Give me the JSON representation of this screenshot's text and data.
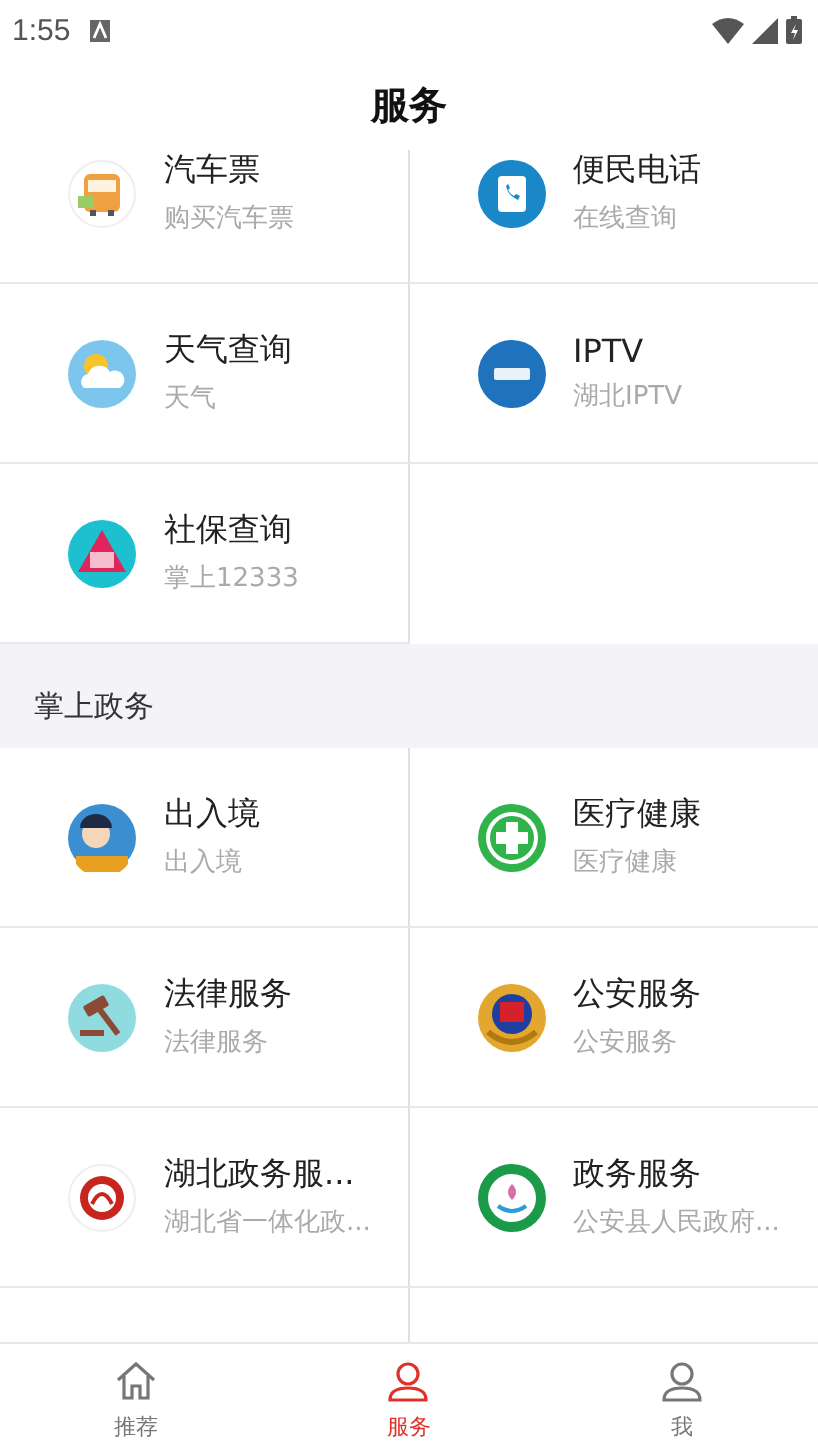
{
  "status_bar": {
    "time": "1:55"
  },
  "title": "服务",
  "sections": [
    {
      "items": [
        {
          "kind": "bus",
          "title": "汽车票",
          "subtitle": "购买汽车票"
        },
        {
          "kind": "phone",
          "title": "便民电话",
          "subtitle": "在线查询"
        },
        {
          "kind": "weather",
          "title": "天气查询",
          "subtitle": "天气"
        },
        {
          "kind": "iptv",
          "title": "IPTV",
          "subtitle": "湖北IPTV"
        },
        {
          "kind": "social",
          "title": "社保查询",
          "subtitle": "掌上12333"
        }
      ]
    },
    {
      "header": "掌上政务",
      "items": [
        {
          "kind": "officer",
          "title": "出入境",
          "subtitle": "出入境"
        },
        {
          "kind": "medical",
          "title": "医疗健康",
          "subtitle": "医疗健康"
        },
        {
          "kind": "gavel",
          "title": "法律服务",
          "subtitle": "法律服务"
        },
        {
          "kind": "emblem",
          "title": "公安服务",
          "subtitle": "公安服务"
        },
        {
          "kind": "seal",
          "title": "湖北政务服...",
          "subtitle": "湖北省一体化政..."
        },
        {
          "kind": "lotus",
          "title": "政务服务",
          "subtitle": "公安县人民政府..."
        }
      ]
    }
  ],
  "tabs": [
    {
      "kind": "home",
      "label": "推荐",
      "selected": false
    },
    {
      "kind": "person",
      "label": "服务",
      "selected": true
    },
    {
      "kind": "person",
      "label": "我",
      "selected": false
    }
  ]
}
